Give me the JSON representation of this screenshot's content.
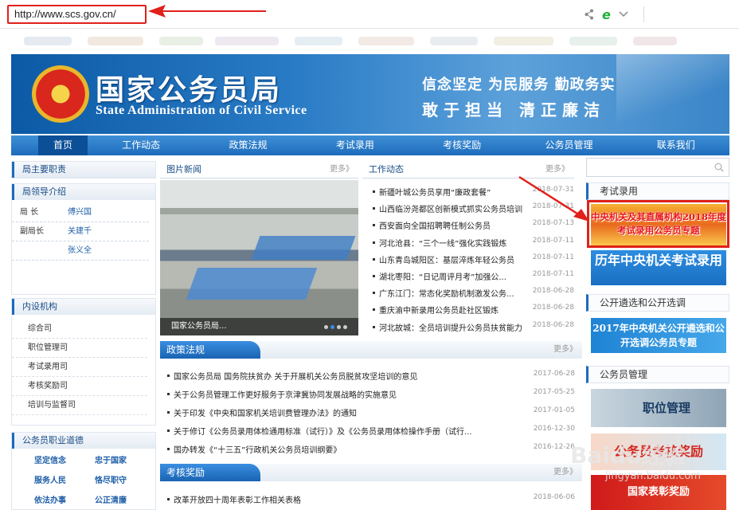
{
  "browser": {
    "url": "http://www.scs.gov.cn/",
    "icons": [
      "share-icon",
      "ie-icon",
      "chevron-down-icon"
    ]
  },
  "banner": {
    "site_name": "国家公务员局",
    "site_name_en": "State Administration of Civil Service",
    "slogan1": "信念坚定 为民服务 勤政务实",
    "slogan2": "敢于担当 清正廉洁"
  },
  "nav": [
    "首页",
    "工作动态",
    "政策法规",
    "考试录用",
    "考核奖励",
    "公务员管理",
    "联系我们"
  ],
  "left": {
    "duties": "局主要职责",
    "leaders_title": "局领导介绍",
    "leaders": [
      {
        "role": "局 长",
        "name": "傅兴国"
      },
      {
        "role": "副局长",
        "name": "关建千"
      },
      {
        "role": "",
        "name": "张义全"
      }
    ],
    "depts_title": "内设机构",
    "depts": [
      "综合司",
      "职位管理司",
      "考试录用司",
      "考核奖励司",
      "培训与监督司"
    ],
    "ethics_title": "公务员职业道德",
    "ethics": [
      "坚定信念",
      "忠于国家",
      "服务人民",
      "恪尽职守",
      "依法办事",
      "公正清廉"
    ]
  },
  "middle": {
    "photo_title": "图片新闻",
    "photo_caption": "国家公务员局...",
    "more": "更多》",
    "work_title": "工作动态",
    "work_news": [
      {
        "t": "新疆叶城公务员享用“廉政套餐”",
        "d": "2018-07-31"
      },
      {
        "t": "山西临汾尧都区创新模式抓实公务员培训",
        "d": "2018-07-31"
      },
      {
        "t": "西安面向全国招聘聘任制公务员",
        "d": "2018-07-13"
      },
      {
        "t": "河北沧县：“三个一线”强化实践锻炼",
        "d": "2018-07-11"
      },
      {
        "t": "山东青岛城阳区：基层淬炼年轻公务员",
        "d": "2018-07-11"
      },
      {
        "t": "湖北枣阳：“日记周评月考”加强公...",
        "d": "2018-07-11"
      },
      {
        "t": "广东江门：常态化奖励机制激发公务...",
        "d": "2018-06-28"
      },
      {
        "t": "重庆渝中新录用公务员赴社区锻炼",
        "d": "2018-06-28"
      },
      {
        "t": "河北故城：全员培训提升公务员扶贫能力",
        "d": "2018-06-28"
      }
    ],
    "policy_title": "政策法规",
    "policy_news": [
      {
        "t": "国家公务员局 国务院扶贫办 关于开展机关公务员脱贫攻坚培训的意见",
        "d": "2017-06-28"
      },
      {
        "t": "关于公务员管理工作更好服务于京津冀协同发展战略的实施意见",
        "d": "2017-05-25"
      },
      {
        "t": "关于印发《中央和国家机关培训费管理办法》的通知",
        "d": "2017-01-05"
      },
      {
        "t": "关于修订《公务员录用体检通用标准（试行）》及《公务员录用体检操作手册（试行...",
        "d": "2016-12-30"
      },
      {
        "t": "国办转发《“十三五”行政机关公务员培训纲要》",
        "d": "2016-12-26"
      }
    ],
    "reward_title": "考核奖励",
    "reward_news": [
      {
        "t": "改革开放四十周年表彰工作相关表格",
        "d": "2018-06-06"
      }
    ]
  },
  "right": {
    "exam_title": "考试录用",
    "exam_banner1": "中央机关及其直属机构2018年度考试录用公务员专题",
    "exam_banner2": "历年中央机关考试录用",
    "select_title": "公开遴选和公开选调",
    "select_banner": "2017年中央机关公开遴选和公开选调公务员专题",
    "manage_title": "公务员管理",
    "manage_banner1": "职位管理",
    "manage_banner2": "公务员考核奖励",
    "manage_banner3": "国家表彰奖励"
  },
  "watermark": {
    "text": "Baidu经验",
    "url": "jingyan.baidu.com"
  }
}
